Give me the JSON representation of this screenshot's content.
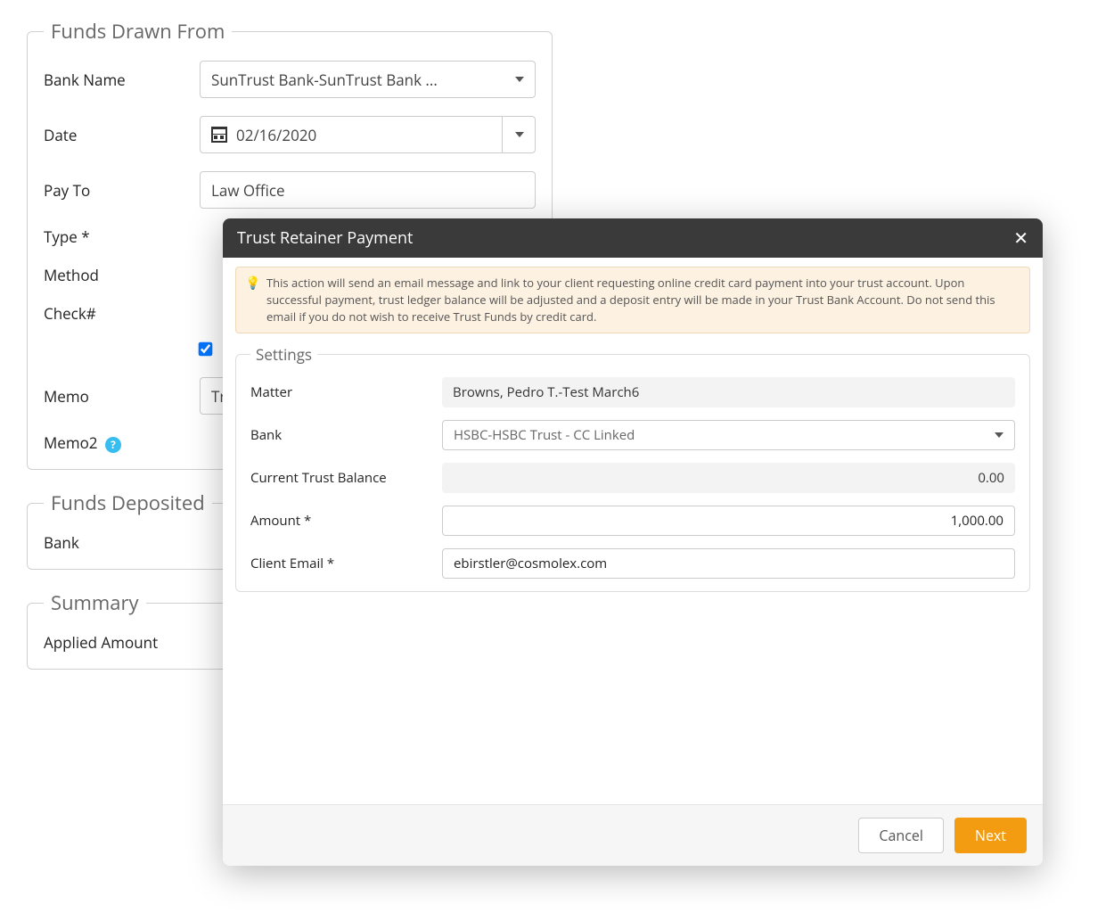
{
  "funds_drawn": {
    "legend": "Funds Drawn From",
    "bank_name_label": "Bank Name",
    "bank_name_value": "SunTrust Bank-SunTrust Bank ...",
    "date_label": "Date",
    "date_value": "02/16/2020",
    "pay_to_label": "Pay To",
    "pay_to_value": "Law Office",
    "type_label": "Type *",
    "method_label": "Method",
    "check_label": "Check#",
    "memo_label": "Memo",
    "memo_value": "Tr",
    "memo2_label": "Memo2"
  },
  "funds_deposited": {
    "legend": "Funds Deposited",
    "bank_label": "Bank"
  },
  "summary": {
    "legend": "Summary",
    "applied_label": "Applied Amount"
  },
  "modal": {
    "title": "Trust Retainer Payment",
    "info": "This action will send an email message and link to your client requesting online credit card payment into your trust account. Upon successful payment, trust ledger balance will be adjusted and a deposit entry will be made in your Trust Bank Account. Do not send this email if you do not wish to receive Trust Funds by credit card.",
    "settings_legend": "Settings",
    "matter_label": "Matter",
    "matter_value": "Browns, Pedro T.-Test March6",
    "bank_label": "Bank",
    "bank_value": "HSBC-HSBC Trust - CC Linked",
    "balance_label": "Current Trust Balance",
    "balance_value": "0.00",
    "amount_label": "Amount *",
    "amount_value": "1,000.00",
    "email_label": "Client Email *",
    "email_value": "ebirstler@cosmolex.com",
    "cancel": "Cancel",
    "next": "Next"
  }
}
